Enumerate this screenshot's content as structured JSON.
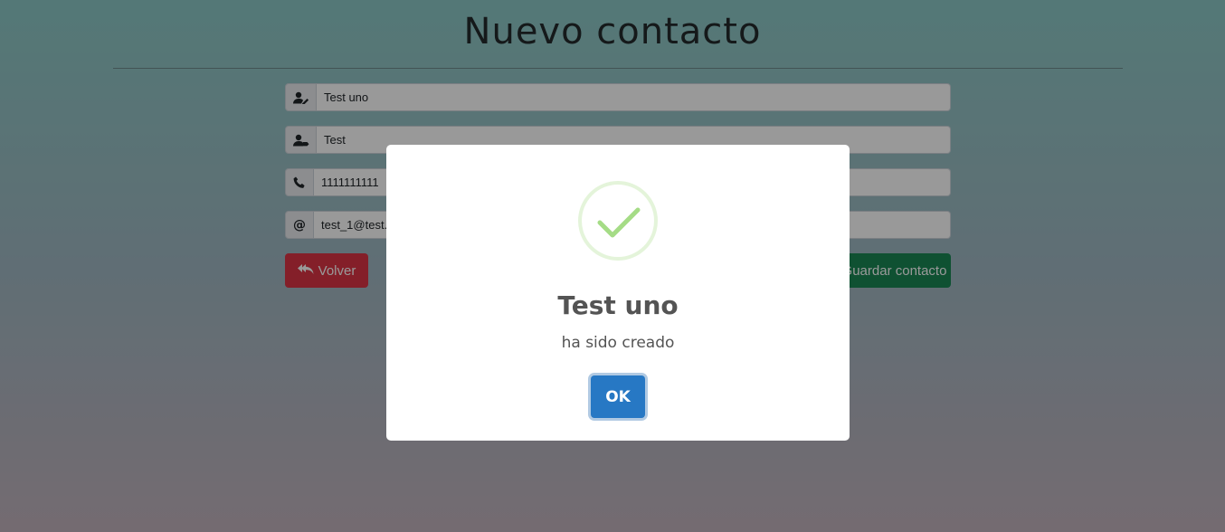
{
  "page": {
    "title": "Nuevo contacto"
  },
  "form": {
    "name": {
      "icon": "user-pen-icon",
      "value": "Test uno"
    },
    "surname": {
      "icon": "user-tag-icon",
      "value": "Test"
    },
    "phone": {
      "icon": "phone-icon",
      "value": "1111111111"
    },
    "email": {
      "icon": "at-icon",
      "prefix": "@",
      "value": "test_1@test.com"
    },
    "back_label": "Volver",
    "save_label": "Guardar contacto"
  },
  "modal": {
    "icon": "success-check-icon",
    "title": "Test uno",
    "text": "ha sido creado",
    "ok_label": "OK"
  },
  "colors": {
    "back_button": "#dc3545",
    "save_button": "#198754",
    "ok_button": "#2778c4",
    "success": "#a5dc86"
  }
}
